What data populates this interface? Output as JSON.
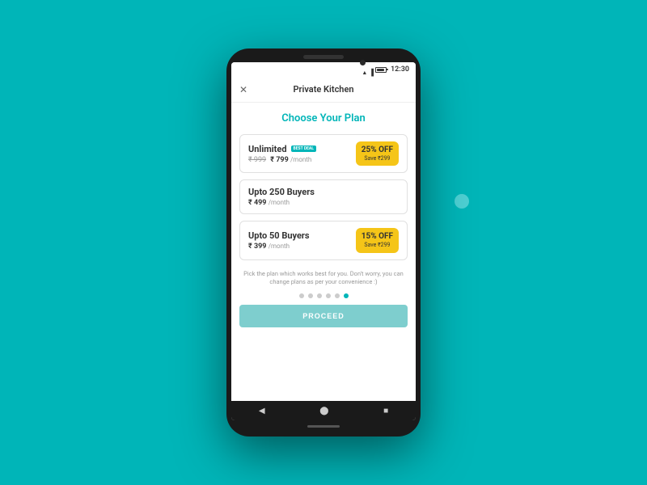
{
  "background": {
    "color": "#00B5B8"
  },
  "status_bar": {
    "time": "12:30"
  },
  "header": {
    "title": "Private Kitchen",
    "close_label": "✕"
  },
  "main": {
    "section_title": "Choose Your Plan",
    "plans": [
      {
        "id": "unlimited",
        "name": "Unlimited",
        "badge": "BEST DEAL",
        "price_original": "₹ 999",
        "price_current": "₹ 799",
        "period": "/month",
        "has_discount": true,
        "discount_percent": "25% OFF",
        "discount_save": "Save ₹299"
      },
      {
        "id": "upto250",
        "name": "Upto 250 Buyers",
        "badge": "",
        "price_original": "",
        "price_current": "₹ 499",
        "period": "/month",
        "has_discount": false,
        "discount_percent": "",
        "discount_save": ""
      },
      {
        "id": "upto50",
        "name": "Upto 50 Buyers",
        "badge": "",
        "price_original": "",
        "price_current": "₹ 399",
        "period": "/month",
        "has_discount": true,
        "discount_percent": "15% OFF",
        "discount_save": "Save ₹299"
      }
    ],
    "footnote": "Pick the plan which works best for you. Don't worry, you can change plans as per your convenience :)",
    "dots": [
      false,
      false,
      false,
      false,
      false,
      true
    ],
    "proceed_label": "PROCEED"
  },
  "bottom_nav": {
    "back": "◀",
    "home": "⬤",
    "recent": "■"
  }
}
